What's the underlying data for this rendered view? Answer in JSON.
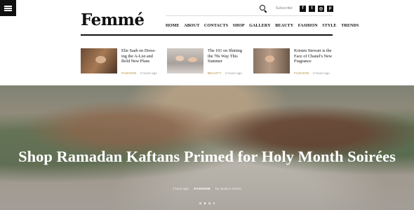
{
  "brand": {
    "logo": "Femmé"
  },
  "utility": {
    "subscribe_label": "Subscribe",
    "social": [
      {
        "icon": "facebook-icon",
        "glyph": "f"
      },
      {
        "icon": "twitter-icon",
        "glyph": "t"
      },
      {
        "icon": "instagram-icon",
        "glyph": "◎"
      },
      {
        "icon": "pinterest-icon",
        "glyph": "p"
      }
    ]
  },
  "nav": {
    "items": [
      "HOME",
      "ABOUT",
      "CONTACTS",
      "SHOP",
      "GALLERY",
      "BEAUTY",
      "FASHION",
      "STYLE",
      "TRENDS"
    ]
  },
  "cards": [
    {
      "title": "Elie Saab on Dress-ing the A-List and Bold New Plans",
      "category": "FASHION",
      "time": "2 hours ago"
    },
    {
      "title": "The 101 on Shining the 70s Way This Summer",
      "category": "BEAUTY",
      "time": "2 hours ago"
    },
    {
      "title": "Kristen Stewart is the Face of Chanel's New Fragrance",
      "category": "FASHION",
      "time": "4 hours ago"
    }
  ],
  "hero": {
    "title": "Shop Ramadan Kaftans Primed for Holy Month Soirées",
    "time": "1 hour ago",
    "category": "FASHION",
    "author": "by Jessica Green"
  },
  "colors": {
    "accent": "#b08e3c",
    "text": "#111111"
  }
}
